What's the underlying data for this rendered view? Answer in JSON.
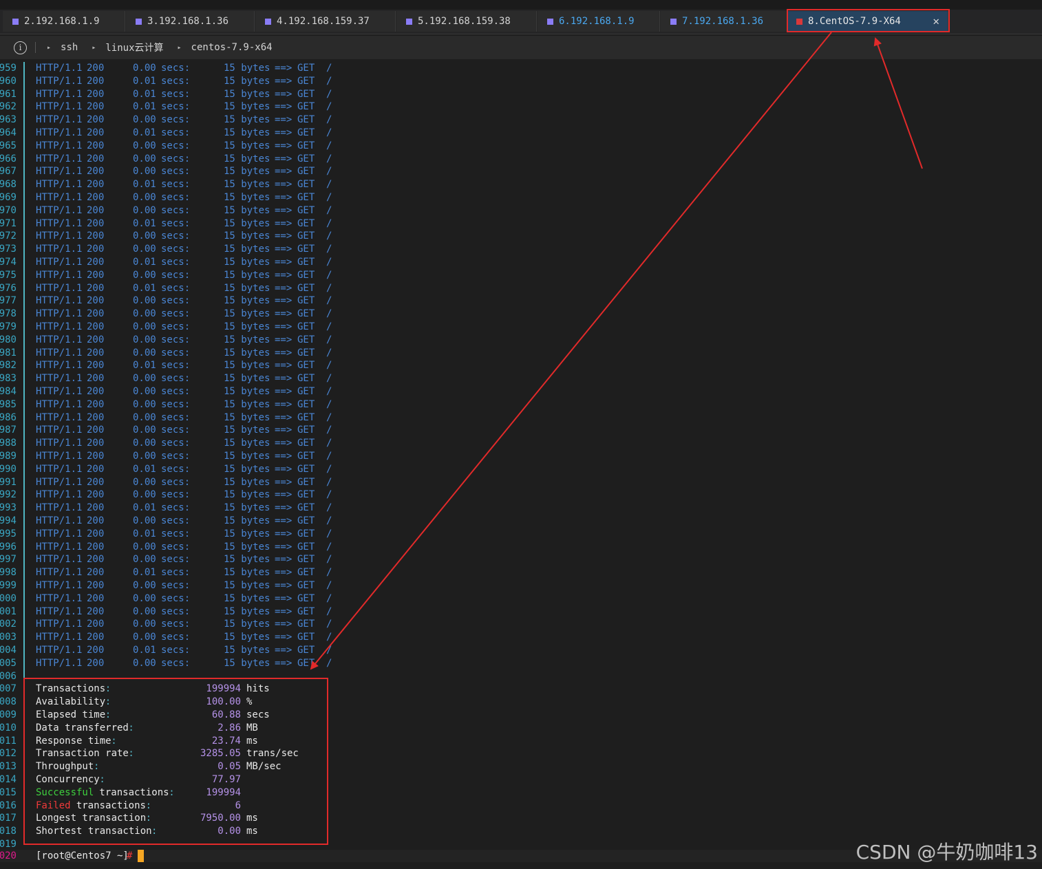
{
  "tabs": [
    {
      "label": "2.192.168.1.9",
      "blue": false,
      "active": false
    },
    {
      "label": "3.192.168.1.36",
      "blue": false,
      "active": false
    },
    {
      "label": "4.192.168.159.37",
      "blue": false,
      "active": false
    },
    {
      "label": "5.192.168.159.38",
      "blue": false,
      "active": false
    },
    {
      "label": "6.192.168.1.9",
      "blue": true,
      "active": false
    },
    {
      "label": "7.192.168.1.36",
      "blue": true,
      "active": false
    },
    {
      "label": "8.CentOS-7.9-X64",
      "blue": false,
      "active": true
    }
  ],
  "breadcrumb": [
    "ssh",
    "linux云计算",
    "centos-7.9-x64"
  ],
  "log_lines": [
    {
      "n": "959",
      "t": "0.00"
    },
    {
      "n": "960",
      "t": "0.01"
    },
    {
      "n": "961",
      "t": "0.01"
    },
    {
      "n": "962",
      "t": "0.01"
    },
    {
      "n": "963",
      "t": "0.00"
    },
    {
      "n": "964",
      "t": "0.01"
    },
    {
      "n": "965",
      "t": "0.00"
    },
    {
      "n": "966",
      "t": "0.00"
    },
    {
      "n": "967",
      "t": "0.00"
    },
    {
      "n": "968",
      "t": "0.01"
    },
    {
      "n": "969",
      "t": "0.00"
    },
    {
      "n": "970",
      "t": "0.00"
    },
    {
      "n": "971",
      "t": "0.01"
    },
    {
      "n": "972",
      "t": "0.00"
    },
    {
      "n": "973",
      "t": "0.00"
    },
    {
      "n": "974",
      "t": "0.01"
    },
    {
      "n": "975",
      "t": "0.00"
    },
    {
      "n": "976",
      "t": "0.01"
    },
    {
      "n": "977",
      "t": "0.00"
    },
    {
      "n": "978",
      "t": "0.00"
    },
    {
      "n": "979",
      "t": "0.00"
    },
    {
      "n": "980",
      "t": "0.00"
    },
    {
      "n": "981",
      "t": "0.00"
    },
    {
      "n": "982",
      "t": "0.01"
    },
    {
      "n": "983",
      "t": "0.00"
    },
    {
      "n": "984",
      "t": "0.00"
    },
    {
      "n": "985",
      "t": "0.00"
    },
    {
      "n": "986",
      "t": "0.00"
    },
    {
      "n": "987",
      "t": "0.00"
    },
    {
      "n": "988",
      "t": "0.00"
    },
    {
      "n": "989",
      "t": "0.00"
    },
    {
      "n": "990",
      "t": "0.01"
    },
    {
      "n": "991",
      "t": "0.00"
    },
    {
      "n": "992",
      "t": "0.00"
    },
    {
      "n": "993",
      "t": "0.01"
    },
    {
      "n": "994",
      "t": "0.00"
    },
    {
      "n": "995",
      "t": "0.01"
    },
    {
      "n": "996",
      "t": "0.00"
    },
    {
      "n": "997",
      "t": "0.00"
    },
    {
      "n": "998",
      "t": "0.01"
    },
    {
      "n": "999",
      "t": "0.00"
    },
    {
      "n": "000",
      "t": "0.00"
    },
    {
      "n": "001",
      "t": "0.00"
    },
    {
      "n": "002",
      "t": "0.00"
    },
    {
      "n": "003",
      "t": "0.00"
    },
    {
      "n": "004",
      "t": "0.01"
    },
    {
      "n": "005",
      "t": "0.00"
    }
  ],
  "log_fields": {
    "proto": "HTTP/1.1",
    "status": "200",
    "secs": "secs:",
    "size": "15 bytes",
    "arrow": "==>",
    "method": "GET",
    "path": "/"
  },
  "blank_line_number": "006",
  "stats": [
    {
      "n": "007",
      "pre": "",
      "label": "Transactions",
      "colon_pad": ":             ",
      "value": "199994",
      "unit": "hits"
    },
    {
      "n": "008",
      "pre": "",
      "label": "Availability",
      "colon_pad": ":                ",
      "value": "100.00",
      "unit": "%"
    },
    {
      "n": "009",
      "pre": "",
      "label": "Elapsed time",
      "colon_pad": ":                 ",
      "value": "60.88",
      "unit": "secs"
    },
    {
      "n": "010",
      "pre": "",
      "label": "Data transferred",
      "colon_pad": ":                 ",
      "value": "2.86",
      "unit": "MB"
    },
    {
      "n": "011",
      "pre": "",
      "label": "Response time",
      "colon_pad": ":                 ",
      "value": "23.74",
      "unit": "ms"
    },
    {
      "n": "012",
      "pre": "",
      "label": "Transaction rate",
      "colon_pad": ":            ",
      "value": "3285.05",
      "unit": "trans/sec"
    },
    {
      "n": "013",
      "pre": "",
      "label": "Throughput",
      "colon_pad": ":                   ",
      "value": "0.05",
      "unit": "MB/sec"
    },
    {
      "n": "014",
      "pre": "",
      "label": "Concurrency",
      "colon_pad": ":                  ",
      "value": "77.97",
      "unit": ""
    },
    {
      "n": "015",
      "pre": "Successful",
      "label": " transactions",
      "colon_pad": ":   ",
      "value": "199994",
      "unit": ""
    },
    {
      "n": "016",
      "pre": "Failed",
      "label": " transactions",
      "colon_pad": ":              ",
      "value": "6",
      "unit": ""
    },
    {
      "n": "017",
      "pre": "",
      "label": "Longest transaction",
      "colon_pad": ":          ",
      "value": "7950.00",
      "unit": "ms"
    },
    {
      "n": "018",
      "pre": "",
      "label": "Shortest transaction",
      "colon_pad": ":            ",
      "value": "0.00",
      "unit": "ms"
    }
  ],
  "end_line_number": "019",
  "prompt": {
    "n": "020",
    "text": "[root@Centos7 ~]",
    "symbol": "#"
  },
  "watermark": "CSDN @牛奶咖啡13",
  "colors": {
    "highlight": "#e22a2a",
    "active_tab": "#26435f",
    "cursor": "#f5a623"
  }
}
